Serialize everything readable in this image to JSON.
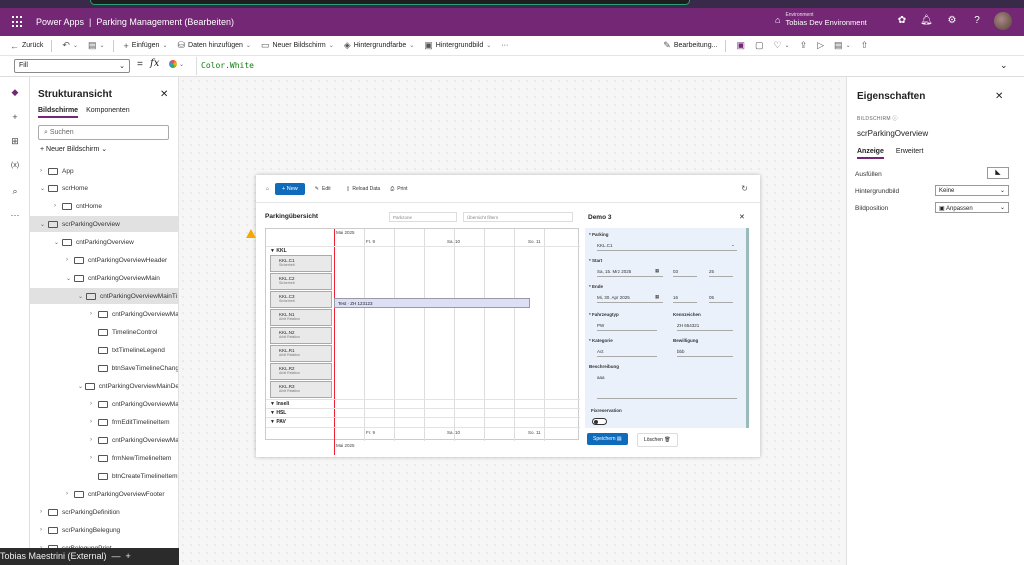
{
  "app": {
    "name": "Power Apps",
    "title": "Parking Management (Bearbeiten)",
    "environment_label": "Environment",
    "environment_name": "Tobias Dev Environment"
  },
  "commands": {
    "back": "Zurück",
    "insert": "Einfügen",
    "add_data": "Daten hinzufügen",
    "new_screen": "Neuer Bildschirm",
    "background_color": "Hintergrundfarbe",
    "background_image": "Hintergrundbild",
    "more": "···",
    "edit_mode": "Bearbeitung..."
  },
  "formula": {
    "property": "Fill",
    "value": "Color.White"
  },
  "tree": {
    "title": "Strukturansicht",
    "tab_screens": "Bildschirme",
    "tab_components": "Komponenten",
    "search_placeholder": "Suchen",
    "new_screen": "Neuer Bildschirm",
    "items": [
      "App",
      "scrHome",
      "cntHome",
      "scrParkingOverview",
      "cntParkingOverview",
      "cntParkingOverviewHeader",
      "cntParkingOverviewMain",
      "cntParkingOverviewMainTi",
      "cntParkingOverviewMa",
      "TimelineControl",
      "txtTimelineLegend",
      "btnSaveTimelineChang",
      "cntParkingOverviewMainDe",
      "cntParkingOverviewMa",
      "frmEditTimelineItem",
      "cntParkingOverviewMa",
      "frmNewTimelineItem",
      "btnCreateTimelineItem",
      "cntParkingOverviewFooter",
      "scrParkingDefinition",
      "scrParkingBelegung",
      "scrBelegungPrint"
    ]
  },
  "user": "Tobias Maestrini (External)",
  "screen": {
    "toolbar": {
      "new": "New",
      "edit": "Edit",
      "reload": "Reload Data",
      "print": "Print"
    },
    "overview_title": "Parkingübersicht",
    "dropdown_placeholder": "Parkzone",
    "filter_placeholder": "Übersicht filtern",
    "timeline": {
      "month_top": "Mai 2025",
      "month_bottom": "Mai 2025",
      "days": [
        "Fr. 9",
        "Sa. 10",
        "So. 11"
      ],
      "groups": [
        "KKL",
        "Inseli",
        "HSL",
        "PAV"
      ],
      "rows": [
        {
          "name": "KKL.C1",
          "sub": "Sicherheit"
        },
        {
          "name": "KKL.C2",
          "sub": "Sicherheit"
        },
        {
          "name": "KKL.C3",
          "sub": "Sicherheit"
        },
        {
          "name": "KKL.N1",
          "sub": "Arbit Relation"
        },
        {
          "name": "KKL.N2",
          "sub": "Arbit Relation"
        },
        {
          "name": "KKL.R1",
          "sub": "Arbit Relation"
        },
        {
          "name": "KKL.R2",
          "sub": "Arbit Relation"
        },
        {
          "name": "KKL.R3",
          "sub": "Arbit Relation"
        }
      ],
      "event": "Test · ZH 123123"
    },
    "form": {
      "title": "Demo 3",
      "parking_label": "Parking",
      "parking_value": "KKL.C1",
      "start_label": "Start",
      "start_date": "Sa, 15. Mrz 2025",
      "start_hour": "03",
      "start_min": "25",
      "end_label": "Ende",
      "end_date": "Mi, 30. Apr 2025",
      "end_hour": "16",
      "end_min": "05",
      "vehicle_label": "Fahrzeugtyp",
      "vehicle_value": "PW",
      "plate_label": "Kennzeichen",
      "plate_value": "ZH 654321",
      "category_label": "Kategorie",
      "category_value": "Act",
      "permit_label": "Bewilligung",
      "permit_value": "bbb",
      "desc_label": "Beschreibung",
      "desc_value": "aaa",
      "fixres_label": "Fixreservation",
      "save": "Speichern",
      "delete": "Löschen"
    }
  },
  "properties": {
    "title": "Eigenschaften",
    "kind": "BILDSCHIRM",
    "name": "scrParkingOverview",
    "tab_display": "Anzeige",
    "tab_advanced": "Erweitert",
    "fill_label": "Ausfüllen",
    "bgimage_label": "Hintergrundbild",
    "bgimage_value": "Keine",
    "imgpos_label": "Bildposition",
    "imgpos_value": "Anpassen"
  }
}
